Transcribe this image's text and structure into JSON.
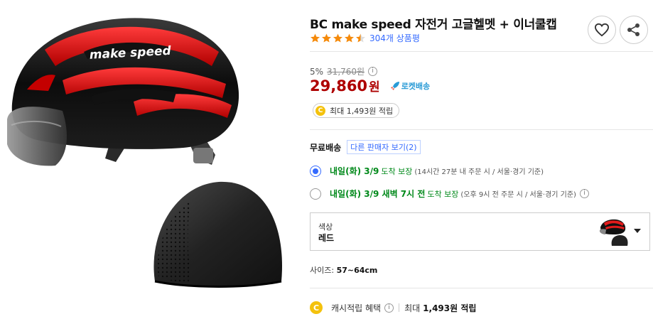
{
  "product": {
    "title": "BC make speed 자전거 고글헬멧 + 이너쿨캡",
    "rating": 4.5,
    "review_count": "304개 상품평",
    "image_brand_text": "make speed"
  },
  "price": {
    "discount_rate": "5%",
    "original_price": "31,760원",
    "sale_price": "29,860",
    "unit": "원",
    "rocket_label": "로켓배송"
  },
  "cashback_pill": {
    "coin": "C",
    "text": "최대 1,493원 적립"
  },
  "shipping": {
    "label": "무료배송",
    "other_sellers": "다른 판매자 보기(2)"
  },
  "delivery_options": [
    {
      "day": "내일(화) 3/9",
      "word": "도착 보장",
      "note": "(14시간 27분 내 주문 시 / 서울·경기 기준)",
      "selected": true
    },
    {
      "day": "내일(화) 3/9 새벽 7시 전",
      "word": "도착 보장",
      "note": "(오후 9시 전 주문 시 / 서울·경기 기준)",
      "selected": false
    }
  ],
  "option": {
    "label": "색상",
    "value": "레드"
  },
  "size": {
    "label": "사이즈:",
    "value": "57~64cm"
  },
  "benefit": {
    "coin": "C",
    "label": "캐시적립 혜택",
    "max_label": "최대",
    "max_value": "1,493원 적립"
  },
  "icons": {
    "info": "i",
    "heart": "heart-icon",
    "share": "share-icon",
    "rocket": "rocket-icon"
  },
  "colors": {
    "price_red": "#ae0000",
    "link_blue": "#346aff",
    "delivery_green": "#00891a",
    "star_orange": "#f58a0b",
    "coin_yellow": "#f4c20d"
  }
}
